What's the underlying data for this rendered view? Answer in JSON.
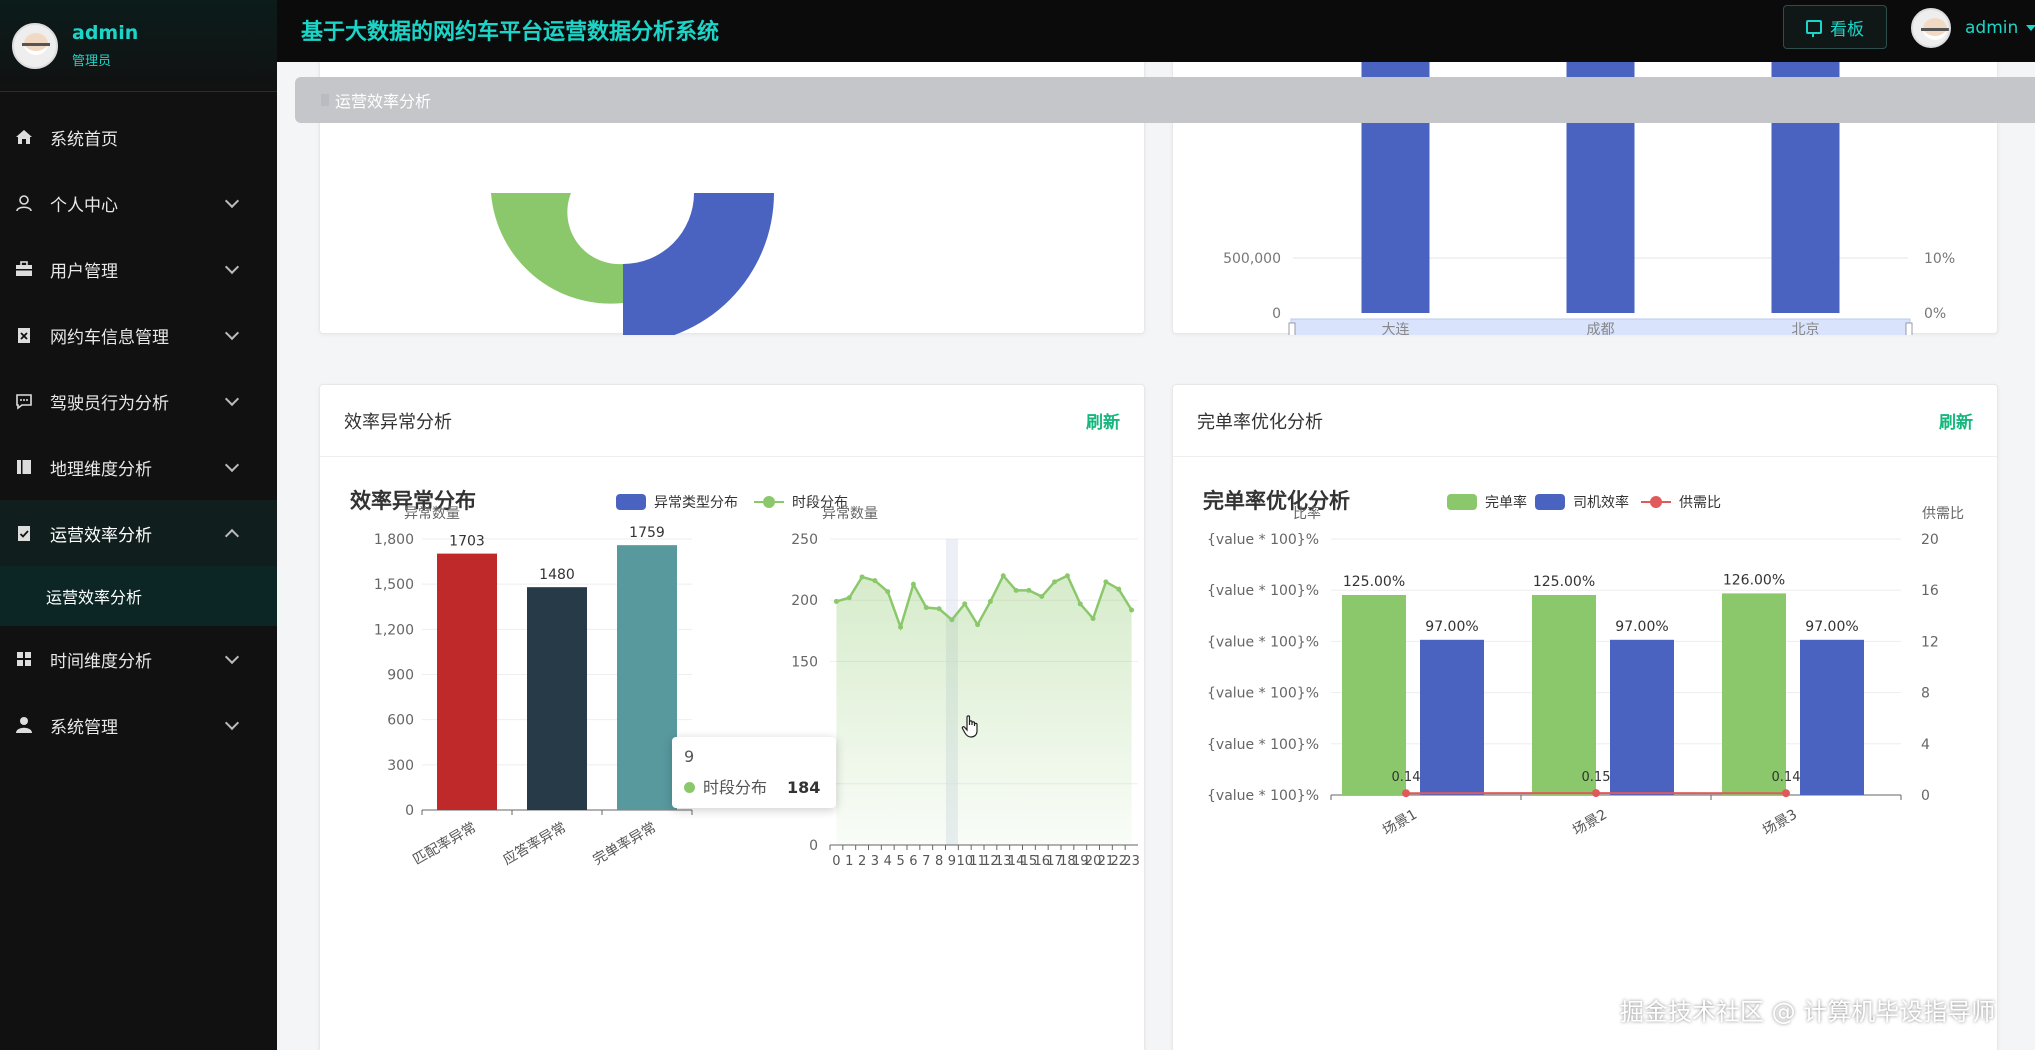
{
  "brand": {
    "name": "admin",
    "role": "管理员"
  },
  "system_title": "基于大数据的网约车平台运营数据分析系统",
  "topbar": {
    "board_label": "看板",
    "user_name": "admin"
  },
  "sidebar": {
    "items": [
      {
        "label": "系统首页",
        "icon": "home-icon"
      },
      {
        "label": "个人中心",
        "icon": "user-icon"
      },
      {
        "label": "用户管理",
        "icon": "briefcase-icon"
      },
      {
        "label": "网约车信息管理",
        "icon": "clipboard-x-icon"
      },
      {
        "label": "驾驶员行为分析",
        "icon": "chat-icon"
      },
      {
        "label": "地理维度分析",
        "icon": "book-icon"
      },
      {
        "label": "运营效率分析",
        "icon": "clipboard-check-icon"
      },
      {
        "label": "时间维度分析",
        "icon": "grid-icon"
      },
      {
        "label": "系统管理",
        "icon": "person-icon"
      }
    ],
    "sub_item": "运营效率分析"
  },
  "breadcrumb": "运营效率分析",
  "cards": {
    "anomaly": {
      "title": "效率异常分析",
      "refresh": "刷新",
      "chart_title": "效率异常分布"
    },
    "completion": {
      "title": "完单率优化分析",
      "refresh": "刷新",
      "chart_title": "完单率优化分析"
    }
  },
  "tooltip": {
    "header": "9",
    "series": "时段分布",
    "value": "184"
  },
  "watermark": "掘金技术社区 @ 计算机毕设指导师",
  "colors": {
    "accent": "#1bd6c8",
    "green": "#8bc86b",
    "blue": "#4a63c0",
    "red": "#e05a5a",
    "refresh": "#15b77e"
  },
  "chart_data": [
    {
      "type": "pie",
      "note": "donut, partially visible at top-left",
      "series": [
        {
          "name": "",
          "values": []
        }
      ]
    },
    {
      "type": "bar",
      "categories": [
        "大连",
        "成都",
        "北京"
      ],
      "y_left_ticks": [
        "0",
        "500,000"
      ],
      "y_right_ticks": [
        "0%",
        "10%"
      ],
      "has_datazoom": true
    },
    {
      "type": "bar",
      "title": "效率异常分布",
      "ylabel": "异常数量",
      "legend": [
        "异常类型分布",
        "时段分布"
      ],
      "categories": [
        "匹配率异常",
        "应答率异常",
        "完单率异常"
      ],
      "values": [
        1703,
        1480,
        1759
      ],
      "bar_colors": [
        "#c0292a",
        "#273a47",
        "#58999e"
      ],
      "y_ticks": [
        0,
        300,
        600,
        900,
        1200,
        1500,
        1800
      ],
      "y_tick_labels": [
        "0",
        "300",
        "600",
        "900",
        "1,200",
        "1,500",
        "1,800"
      ],
      "ylim": [
        0,
        1800
      ]
    },
    {
      "type": "line",
      "ylabel": "异常数量",
      "series_name": "时段分布",
      "x": [
        0,
        1,
        2,
        3,
        4,
        5,
        6,
        7,
        8,
        9,
        10,
        11,
        12,
        13,
        14,
        15,
        16,
        17,
        18,
        19,
        20,
        21,
        22,
        23
      ],
      "values": [
        199,
        202,
        219,
        216,
        207,
        178,
        213,
        194,
        193,
        184,
        197,
        180,
        199,
        220,
        208,
        208,
        203,
        215,
        220,
        197,
        185,
        215,
        209,
        192
      ],
      "y_ticks": [
        0,
        50,
        150,
        200,
        250
      ],
      "ylim": [
        0,
        250
      ]
    },
    {
      "type": "bar",
      "title": "完单率优化分析",
      "legend": [
        "完单率",
        "司机效率",
        "供需比"
      ],
      "ylabel_left": "比率",
      "ylabel_right": "供需比",
      "categories": [
        "场景1",
        "场景2",
        "场景3"
      ],
      "series": [
        {
          "name": "完单率",
          "values": [
            125.0,
            125.0,
            126.0
          ],
          "labels": [
            "125.00%",
            "125.00%",
            "126.00%"
          ]
        },
        {
          "name": "司机效率",
          "values": [
            97.0,
            97.0,
            97.0
          ],
          "labels": [
            "97.00%",
            "97.00%",
            "97.00%"
          ]
        },
        {
          "name": "供需比",
          "values": [
            0.14,
            0.15,
            0.14
          ],
          "labels": [
            "0.14",
            "0.15",
            "0.14"
          ],
          "axis": "right",
          "kind": "line"
        }
      ],
      "y_left_tick_label": "{value * 100}%",
      "y_left_tick_count": 6,
      "y_right_ticks": [
        0,
        4,
        8,
        12,
        16,
        20
      ],
      "ylim_left": [
        0,
        160
      ],
      "ylim_right": [
        0,
        20
      ]
    }
  ]
}
